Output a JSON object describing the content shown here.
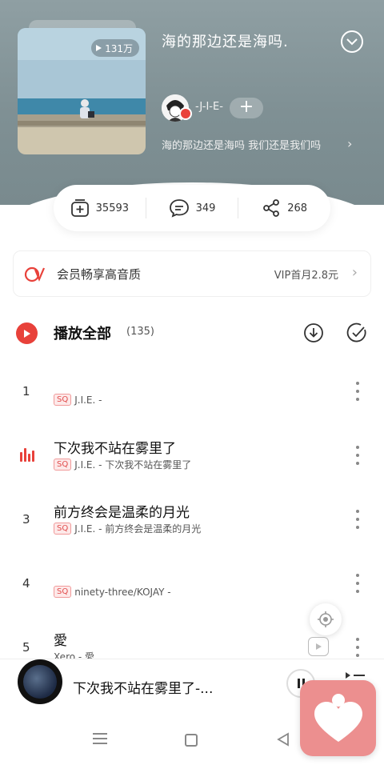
{
  "header": {
    "play_count": "131万",
    "title": "海的那边还是海吗.",
    "creator_name": "-J-I-E-",
    "follow_label": "+",
    "description": "海的那边还是海吗 我们还是我们吗"
  },
  "actions": {
    "collect_count": "35593",
    "comment_count": "349",
    "share_count": "268"
  },
  "vip": {
    "text": "会员畅享高音质",
    "offer": "VIP首月2.8元"
  },
  "play_all": {
    "label": "播放全部",
    "count": "(135)"
  },
  "songs": [
    {
      "index": "1",
      "title": "",
      "quality": "SQ",
      "subtitle": "J.I.E. -"
    },
    {
      "index": "",
      "title": "下次我不站在雾里了",
      "quality": "SQ",
      "subtitle": "J.I.E. - 下次我不站在雾里了",
      "playing": true
    },
    {
      "index": "3",
      "title": "前方终会是温柔的月光",
      "quality": "SQ",
      "subtitle": "J.I.E. - 前方终会是温柔的月光"
    },
    {
      "index": "4",
      "title": "",
      "quality": "SQ",
      "subtitle": "ninety-three/KOJAY -"
    },
    {
      "index": "5",
      "title": "愛",
      "quality": "",
      "subtitle": "Xero - 愛"
    }
  ],
  "mini_player": {
    "title": "下次我不站在雾里了-..."
  },
  "colors": {
    "accent": "#e8413a",
    "header_bg": "#84959a",
    "heart_bg": "#ec8f8f"
  }
}
